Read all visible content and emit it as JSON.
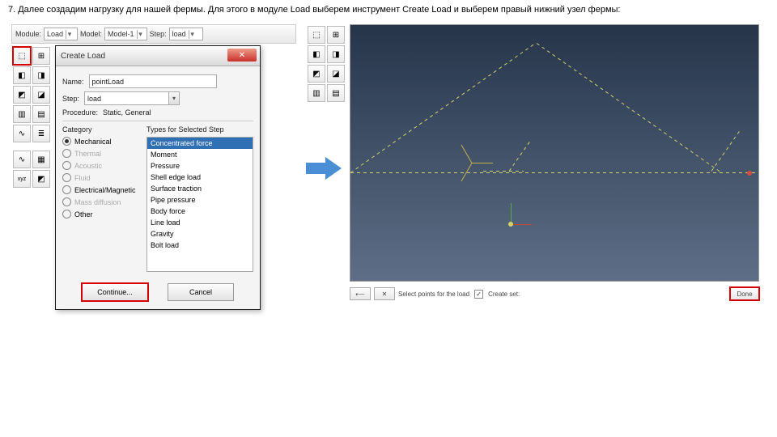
{
  "caption": "7. Далее создадим нагрузку для нашей фермы. Для этого в модуле Load выберем инструмент Create Load и выберем правый нижний узел фермы:",
  "context_bar": {
    "module_label": "Module:",
    "module_value": "Load",
    "model_label": "Model:",
    "model_value": "Model-1",
    "step_label": "Step:",
    "step_value": "load"
  },
  "tool_icons": {
    "create_load": "⬚",
    "bc": "⊞",
    "field": "≣",
    "amp": "∿",
    "a": "◧",
    "b": "◨",
    "c": "◩",
    "d": "◪",
    "e": "▥",
    "f": "▤",
    "g": "xyz",
    "h": "▦"
  },
  "dialog": {
    "title": "Create Load",
    "close": "✕",
    "name_label": "Name:",
    "name_value": "pointLoad",
    "step_label": "Step:",
    "step_value": "load",
    "procedure_label": "Procedure:",
    "procedure_value": "Static, General",
    "category_header": "Category",
    "types_header": "Types for Selected Step",
    "categories": [
      {
        "label": "Mechanical",
        "selected": true,
        "disabled": false
      },
      {
        "label": "Thermal",
        "selected": false,
        "disabled": true
      },
      {
        "label": "Acoustic",
        "selected": false,
        "disabled": true
      },
      {
        "label": "Fluid",
        "selected": false,
        "disabled": true
      },
      {
        "label": "Electrical/Magnetic",
        "selected": false,
        "disabled": false
      },
      {
        "label": "Mass diffusion",
        "selected": false,
        "disabled": true
      },
      {
        "label": "Other",
        "selected": false,
        "disabled": false
      }
    ],
    "types": [
      {
        "label": "Concentrated force",
        "selected": true
      },
      {
        "label": "Moment",
        "selected": false
      },
      {
        "label": "Pressure",
        "selected": false
      },
      {
        "label": "Shell edge load",
        "selected": false
      },
      {
        "label": "Surface traction",
        "selected": false
      },
      {
        "label": "Pipe pressure",
        "selected": false
      },
      {
        "label": "Body force",
        "selected": false
      },
      {
        "label": "Line load",
        "selected": false
      },
      {
        "label": "Gravity",
        "selected": false
      },
      {
        "label": "Bolt load",
        "selected": false
      }
    ],
    "continue_label": "Continue...",
    "cancel_label": "Cancel"
  },
  "prompt_bar": {
    "back": "⟵",
    "fwd": "✕",
    "text": "Select points for the load",
    "checkbox_label": "Create set:",
    "checked_mark": "✓",
    "done_label": "Done"
  }
}
